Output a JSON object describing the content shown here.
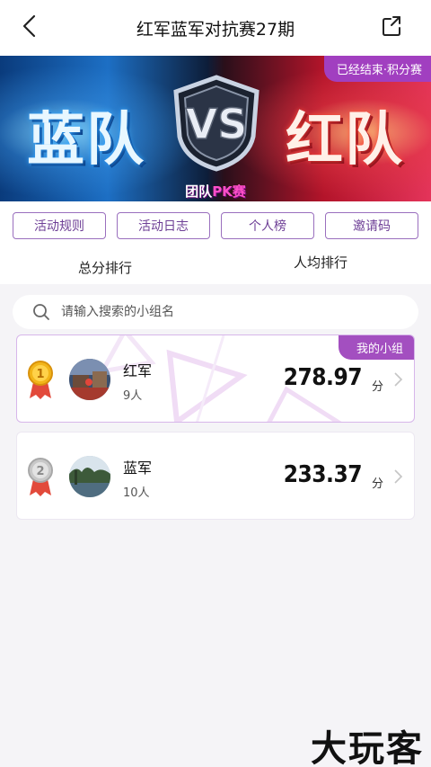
{
  "header": {
    "title": "红军蓝军对抗赛27期"
  },
  "banner": {
    "left_team": "蓝队",
    "vs": "VS",
    "right_team": "红队",
    "subtitle_prefix": "团队",
    "subtitle_accent": "PK赛",
    "status_badge": "已经结束·积分赛"
  },
  "actions": [
    {
      "label": "活动规则"
    },
    {
      "label": "活动日志"
    },
    {
      "label": "个人榜"
    },
    {
      "label": "邀请码"
    }
  ],
  "ranking_tabs": [
    {
      "label": "总分排行"
    },
    {
      "label": "人均排行"
    }
  ],
  "search": {
    "placeholder": "请输入搜索的小组名"
  },
  "groups": [
    {
      "rank": "1",
      "name": "红军",
      "members": "9人",
      "score": "278.97",
      "unit": "分",
      "tag": "我的小组"
    },
    {
      "rank": "2",
      "name": "蓝军",
      "members": "10人",
      "score": "233.37",
      "unit": "分"
    }
  ],
  "watermark": "大玩客",
  "colors": {
    "accent_purple": "#a34fc0",
    "pill_border": "#9a6fbe"
  }
}
